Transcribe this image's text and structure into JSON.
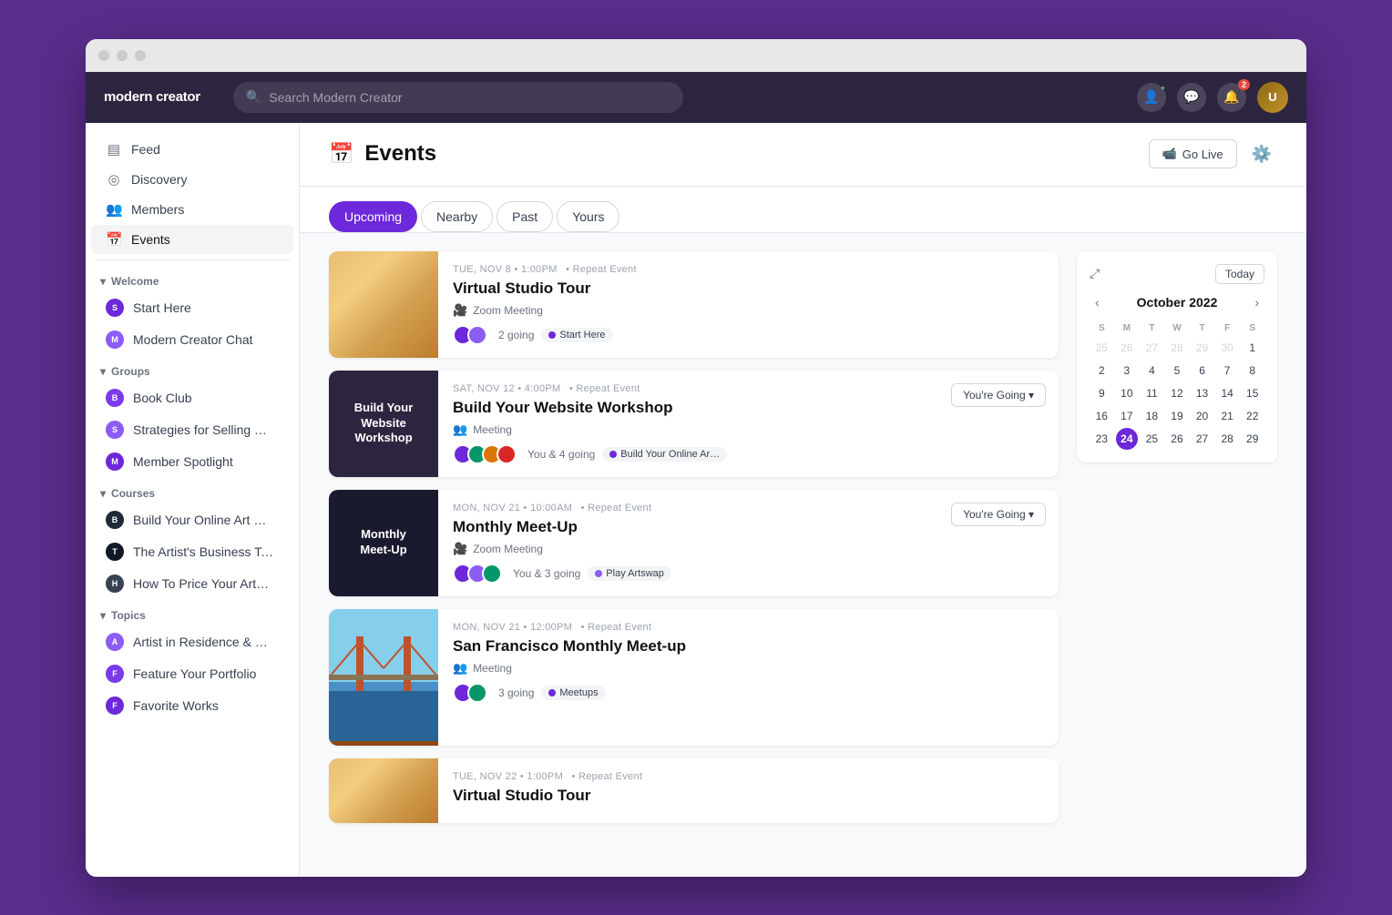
{
  "window": {
    "title": "Modern Creator"
  },
  "topnav": {
    "logo": "modern creator",
    "search_placeholder": "Search Modern Creator",
    "notification_badge": "2"
  },
  "sidebar": {
    "nav_items": [
      {
        "id": "feed",
        "label": "Feed",
        "icon": "▤"
      },
      {
        "id": "discovery",
        "label": "Discovery",
        "icon": "◎"
      },
      {
        "id": "members",
        "label": "Members",
        "icon": "👥"
      },
      {
        "id": "events",
        "label": "Events",
        "icon": "📅",
        "active": true
      }
    ],
    "sections": [
      {
        "id": "welcome",
        "label": "Welcome",
        "collapsed": false,
        "items": [
          {
            "id": "start-here",
            "label": "Start Here",
            "avatar_color": "#6d28d9"
          },
          {
            "id": "modern-creator-chat",
            "label": "Modern Creator Chat",
            "avatar_color": "#8b5cf6"
          }
        ]
      },
      {
        "id": "groups",
        "label": "Groups",
        "collapsed": false,
        "items": [
          {
            "id": "book-club",
            "label": "Book Club",
            "avatar_color": "#7c3aed"
          },
          {
            "id": "strategies",
            "label": "Strategies for Selling Your Art",
            "avatar_color": "#8b5cf6"
          },
          {
            "id": "member-spotlight",
            "label": "Member Spotlight",
            "avatar_color": "#6d28d9"
          }
        ]
      },
      {
        "id": "courses",
        "label": "Courses",
        "collapsed": false,
        "items": [
          {
            "id": "build-online-art",
            "label": "Build Your Online Art Business",
            "avatar_color": "#1f2937"
          },
          {
            "id": "artists-toolkit",
            "label": "The Artist's Business Toolkit",
            "avatar_color": "#111827"
          },
          {
            "id": "how-to-price",
            "label": "How To Price Your Artwork S…",
            "avatar_color": "#374151"
          }
        ]
      },
      {
        "id": "topics",
        "label": "Topics",
        "collapsed": false,
        "items": [
          {
            "id": "artist-residence",
            "label": "Artist in Residence & Grants",
            "avatar_color": "#8b5cf6"
          },
          {
            "id": "feature-portfolio",
            "label": "Feature Your Portfolio",
            "avatar_color": "#7c3aed"
          },
          {
            "id": "favorite-works",
            "label": "Favorite Works",
            "avatar_color": "#6d28d9"
          }
        ]
      }
    ]
  },
  "events_page": {
    "title": "Events",
    "tabs": [
      {
        "id": "upcoming",
        "label": "Upcoming",
        "active": true
      },
      {
        "id": "nearby",
        "label": "Nearby",
        "active": false
      },
      {
        "id": "past",
        "label": "Past",
        "active": false
      },
      {
        "id": "yours",
        "label": "Yours",
        "active": false
      }
    ],
    "go_live_label": "Go Live",
    "events": [
      {
        "id": "virtual-studio-1",
        "date": "TUE, NOV 8 • 1:00PM",
        "repeat": "Repeat Event",
        "title": "Virtual Studio Tour",
        "type": "Zoom Meeting",
        "type_icon": "zoom",
        "attendees_text": "2 going",
        "channel": "Start Here",
        "channel_color": "#6d28d9",
        "going": false,
        "image_type": "virtual-studio"
      },
      {
        "id": "website-workshop",
        "date": "SAT, NOV 12 • 4:00PM",
        "repeat": "Repeat Event",
        "title": "Build Your Website Workshop",
        "type": "Meeting",
        "type_icon": "meeting",
        "attendees_text": "You & 4 going",
        "channel": "Build Your Online Ar…",
        "channel_color": "#6d28d9",
        "going": true,
        "going_label": "You're Going ▾",
        "image_type": "website-workshop",
        "image_text": "Build Your Website Workshop"
      },
      {
        "id": "monthly-meetup",
        "date": "MON, NOV 21 • 10:00AM",
        "repeat": "Repeat Event",
        "title": "Monthly Meet-Up",
        "type": "Zoom Meeting",
        "type_icon": "zoom",
        "attendees_text": "You & 3 going",
        "channel": "Play Artswap",
        "channel_color": "#8b5cf6",
        "going": true,
        "going_label": "You're Going ▾",
        "image_type": "monthly-meetup",
        "image_text": "Monthly Meet-Up"
      },
      {
        "id": "sf-meetup",
        "date": "MON, NOV 21 • 12:00PM",
        "repeat": "Repeat Event",
        "title": "San Francisco Monthly Meet-up",
        "type": "Meeting",
        "type_icon": "meeting",
        "attendees_text": "3 going",
        "channel": "Meetups",
        "channel_color": "#6d28d9",
        "going": false,
        "image_type": "sf-meetup"
      },
      {
        "id": "virtual-studio-2",
        "date": "TUE, NOV 22 • 1:00PM",
        "repeat": "Repeat Event",
        "title": "Virtual Studio Tour",
        "type": "Zoom Meeting",
        "type_icon": "zoom",
        "attendees_text": "",
        "channel": "",
        "going": false,
        "image_type": "virtual-studio2"
      }
    ]
  },
  "calendar": {
    "title": "October 2022",
    "today_label": "Today",
    "day_labels": [
      "S",
      "M",
      "T",
      "W",
      "T",
      "F",
      "S"
    ],
    "weeks": [
      [
        {
          "day": "25",
          "other": true
        },
        {
          "day": "26",
          "other": true
        },
        {
          "day": "27",
          "other": true
        },
        {
          "day": "28",
          "other": true
        },
        {
          "day": "29",
          "other": true
        },
        {
          "day": "30",
          "other": true
        },
        {
          "day": "1",
          "other": false
        }
      ],
      [
        {
          "day": "2"
        },
        {
          "day": "3"
        },
        {
          "day": "4"
        },
        {
          "day": "5"
        },
        {
          "day": "6"
        },
        {
          "day": "7"
        },
        {
          "day": "8"
        }
      ],
      [
        {
          "day": "9"
        },
        {
          "day": "10"
        },
        {
          "day": "11"
        },
        {
          "day": "12"
        },
        {
          "day": "13"
        },
        {
          "day": "14"
        },
        {
          "day": "15"
        }
      ],
      [
        {
          "day": "16"
        },
        {
          "day": "17"
        },
        {
          "day": "18"
        },
        {
          "day": "19"
        },
        {
          "day": "20"
        },
        {
          "day": "21"
        },
        {
          "day": "22"
        }
      ],
      [
        {
          "day": "23"
        },
        {
          "day": "24"
        },
        {
          "day": "25"
        },
        {
          "day": "26"
        },
        {
          "day": "27"
        },
        {
          "day": "28"
        },
        {
          "day": "29"
        }
      ]
    ]
  }
}
